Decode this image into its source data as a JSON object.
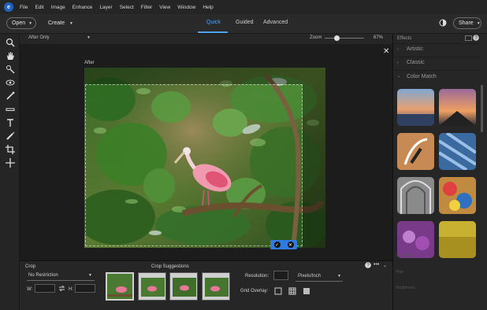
{
  "menu": {
    "items": [
      "File",
      "Edit",
      "Image",
      "Enhance",
      "Layer",
      "Select",
      "Filter",
      "View",
      "Window",
      "Help"
    ]
  },
  "toolbar_top": {
    "open_label": "Open",
    "create_label": "Create",
    "share_label": "Share",
    "modes": [
      "Quick",
      "Guided",
      "Advanced"
    ],
    "active_mode": "Quick"
  },
  "view": {
    "mode": "After Only",
    "zoom_label": "Zoom",
    "zoom_value": "67%",
    "zoom_level": 0.3
  },
  "canvas": {
    "after_label": "After"
  },
  "tools": [
    "zoom-icon",
    "hand-icon",
    "quick-selection-icon",
    "red-eye-icon",
    "whiten-teeth-icon",
    "straighten-icon",
    "type-icon",
    "spot-healing-icon",
    "crop-icon",
    "move-icon"
  ],
  "crop": {
    "title": "Crop",
    "ratio": "No Restriction",
    "w_label": "W:",
    "h_label": "H:",
    "suggestions_label": "Crop Suggestions",
    "resolution_label": "Resolution:",
    "resolution_unit": "Pixels/Inch",
    "grid_label": "Grid Overlay:"
  },
  "effects": {
    "title": "Effects",
    "categories": [
      "Artistic",
      "Classic",
      "Color Match"
    ],
    "faded": [
      "Saturation",
      "Hue",
      "Brightness"
    ]
  },
  "colors": {
    "accent": "#2f7be0",
    "active_tab": "#4fa3f7",
    "panel": "#262626",
    "bg": "#1b1b1b"
  }
}
